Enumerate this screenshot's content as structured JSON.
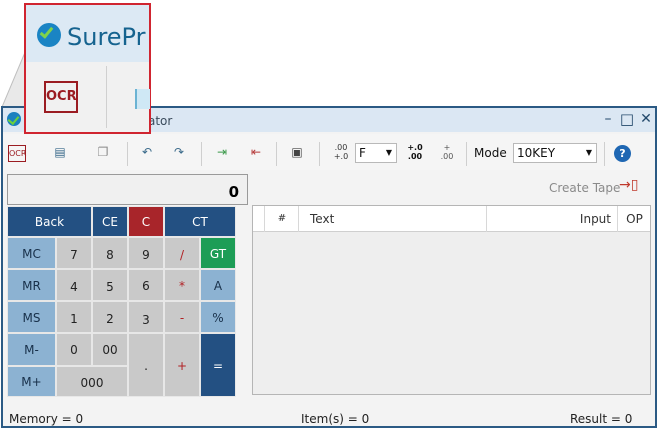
{
  "window": {
    "title": "ator"
  },
  "zoom": {
    "brand": "SurePr",
    "ocr_label": "OCR"
  },
  "toolbar": {
    "ocr": "OCR",
    "decimal_select": "F",
    "mode_label": "Mode",
    "mode_value": "10KEY",
    "format_left_top": ".00",
    "format_left_bottom": "+.0",
    "format_mid_top": "+.0",
    "format_mid_bottom": ".00",
    "format_right_top": "+",
    "format_right_bottom": ".00",
    "help": "?"
  },
  "display": {
    "value": "0"
  },
  "keypad": {
    "back": "Back",
    "ce": "CE",
    "c": "C",
    "ct": "CT",
    "mc": "MC",
    "mr": "MR",
    "ms": "MS",
    "mminus": "M-",
    "mplus": "M+",
    "k7": "7",
    "k8": "8",
    "k9": "9",
    "div": "/",
    "gt": "GT",
    "k4": "4",
    "k5": "5",
    "k6": "6",
    "mul": "*",
    "a": "A",
    "k1": "1",
    "k2": "2",
    "k3": "3",
    "minus": "-",
    "pct": "%",
    "k0": "0",
    "k00": "00",
    "dot": ".",
    "plus": "+",
    "k000": "000",
    "eq": "="
  },
  "tape": {
    "create": "Create Tape",
    "columns": [
      "#",
      "Text",
      "Input",
      "OP"
    ]
  },
  "status": {
    "memory": "Memory = 0",
    "items": "Item(s) = 0",
    "result": "Result = 0"
  }
}
